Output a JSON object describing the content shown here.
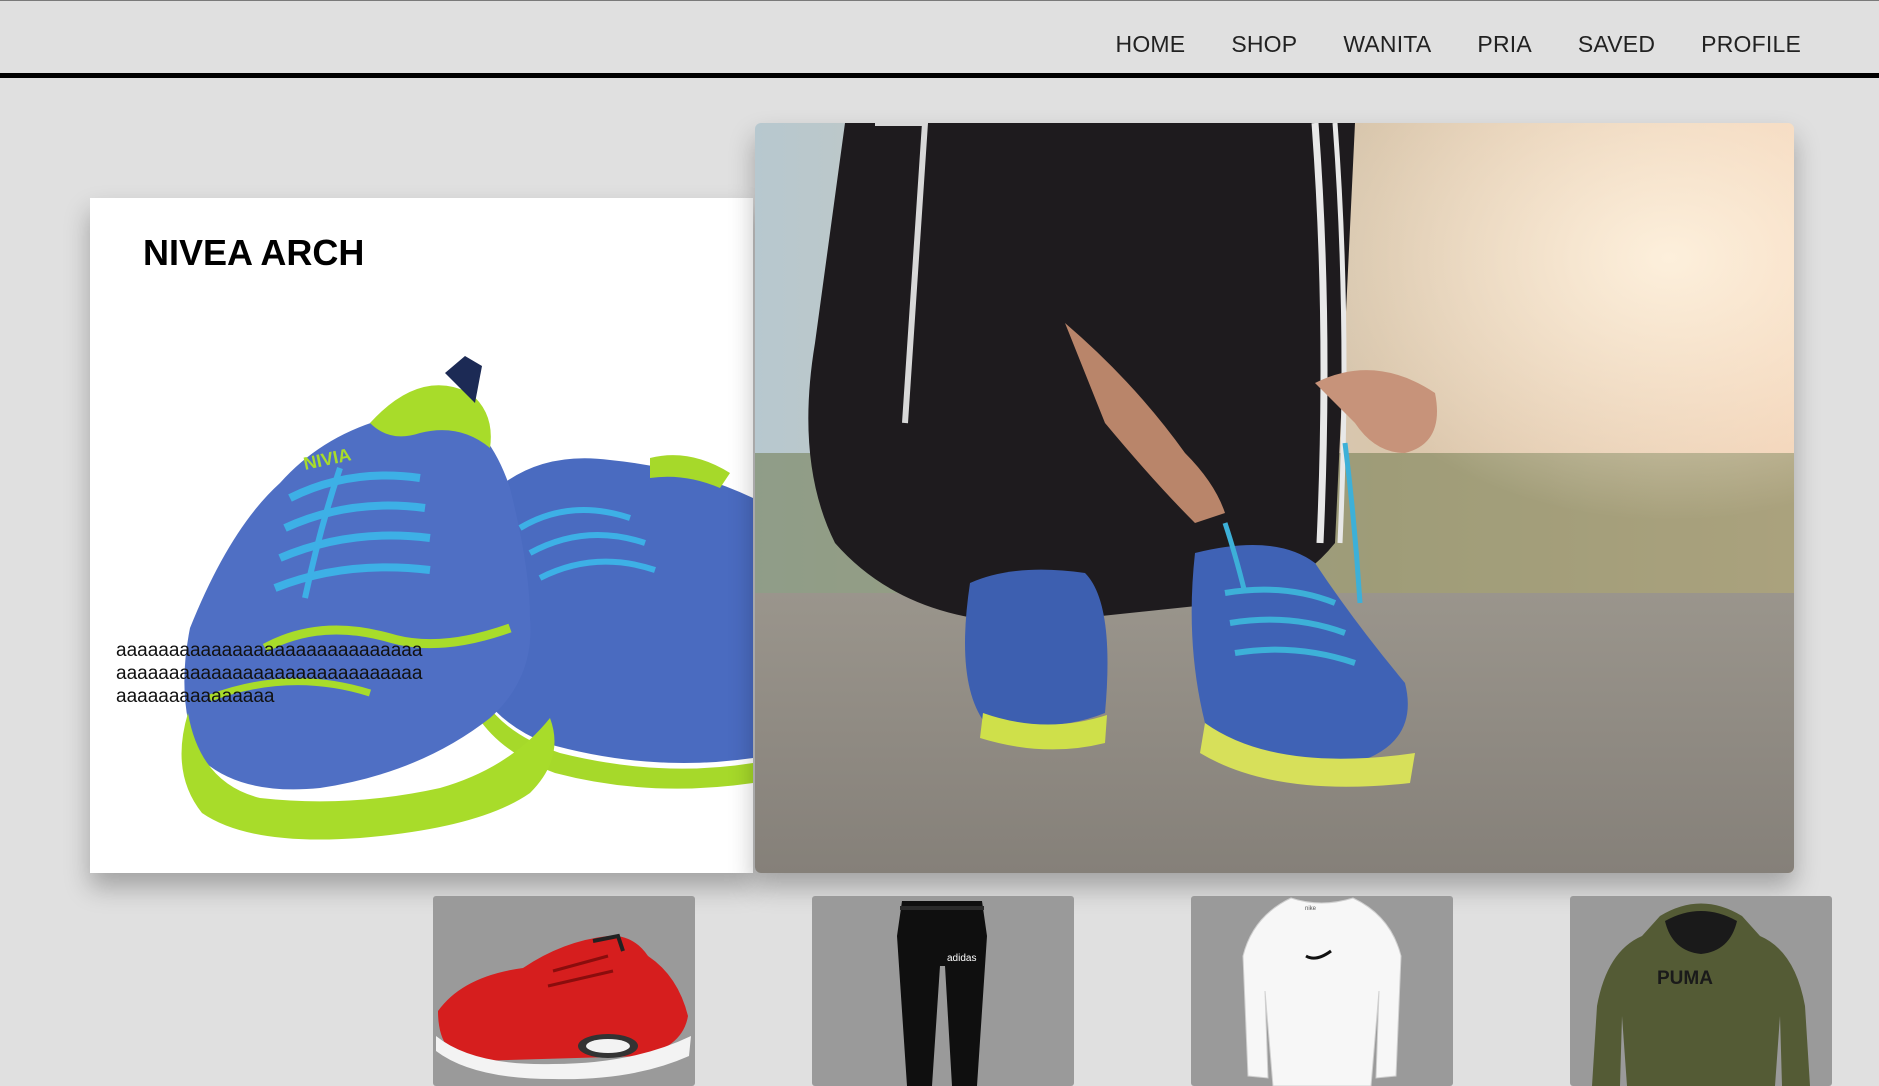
{
  "nav": {
    "items": [
      {
        "label": "HOME"
      },
      {
        "label": "SHOP"
      },
      {
        "label": "WANITA"
      },
      {
        "label": "PRIA"
      },
      {
        "label": "SAVED"
      },
      {
        "label": "PROFILE"
      }
    ]
  },
  "feature": {
    "title": "NIVEA ARCH",
    "description": "aaaaaaaaaaaaaaaaaaaaaaaaaaaaaaaaaaaaaaaaaaaaaaaaaaaaaaaaaaaaaaaaaaaaaaaaa",
    "shoe_brand_mark": "NIVIA"
  },
  "hero": {
    "image": "runner-tying-blue-shoe-photo"
  },
  "products": [
    {
      "image": "red-sneaker"
    },
    {
      "image": "black-jogger-pants",
      "brand": "adidas"
    },
    {
      "image": "white-compression-shirt",
      "brand": "nike"
    },
    {
      "image": "olive-hoodie",
      "brand": "PUMA"
    }
  ],
  "colors": {
    "background": "#e0e0e0",
    "nav_border": "#000000",
    "thumb_bg": "#9a9a9a",
    "shoe_blue": "#4f6fc4",
    "shoe_green": "#a8dc2a"
  }
}
